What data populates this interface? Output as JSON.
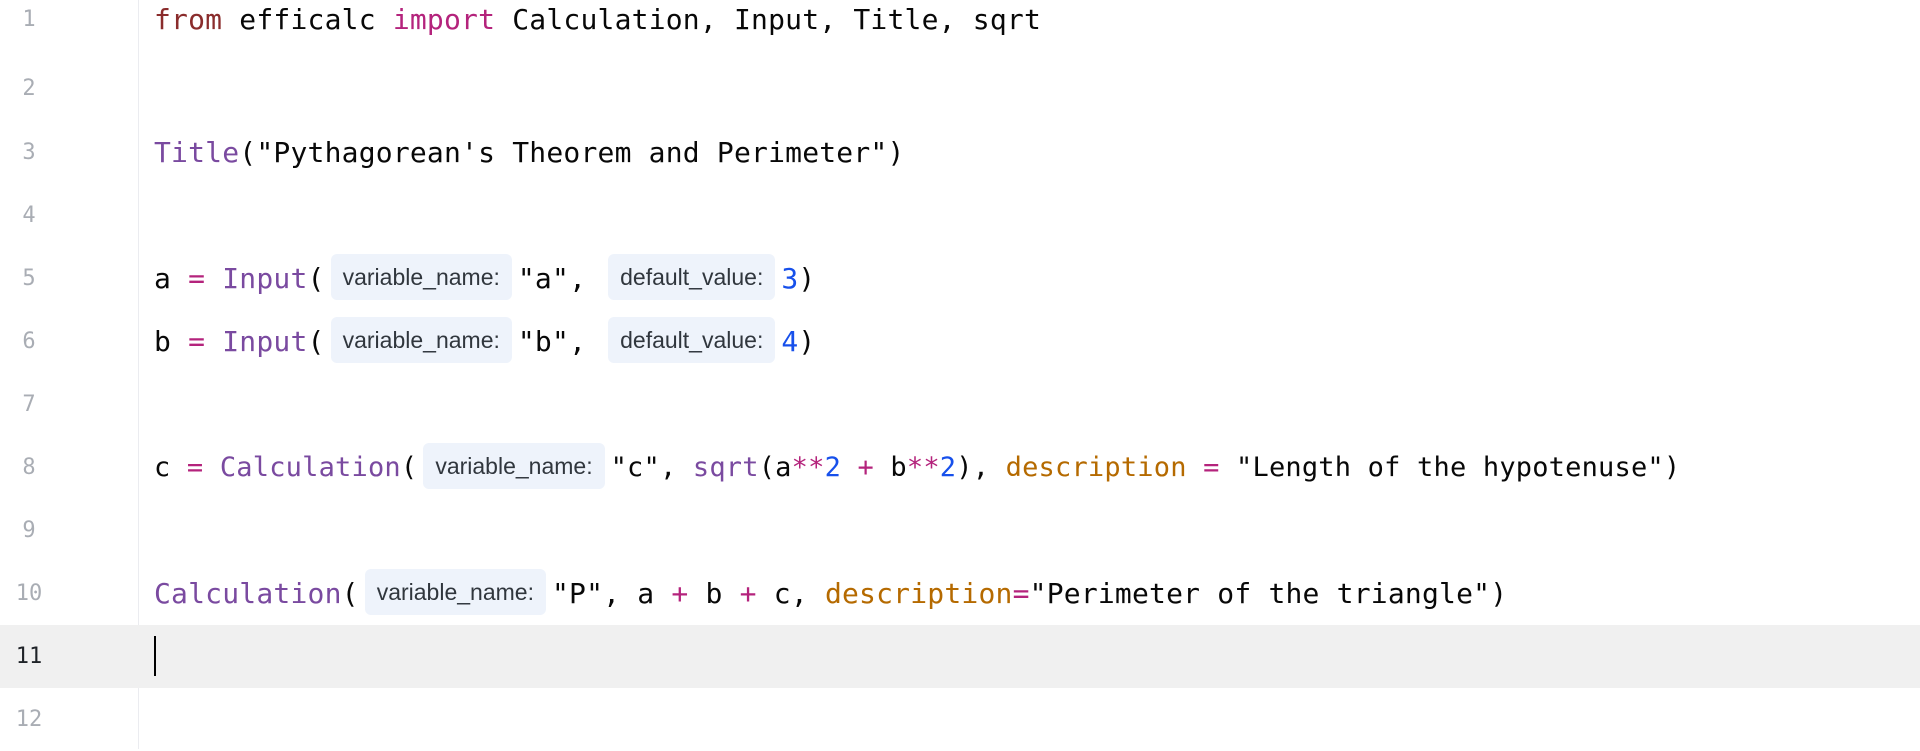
{
  "editor": {
    "lines": [
      {
        "number": "1"
      },
      {
        "number": "2"
      },
      {
        "number": "3"
      },
      {
        "number": "4"
      },
      {
        "number": "5"
      },
      {
        "number": "6"
      },
      {
        "number": "7"
      },
      {
        "number": "8"
      },
      {
        "number": "9"
      },
      {
        "number": "10"
      },
      {
        "number": "11"
      },
      {
        "number": "12"
      }
    ],
    "current_line": "11",
    "tokens": {
      "l1_from": "from",
      "l1_module": " efficalc ",
      "l1_import": "import",
      "l1_names": " Calculation, Input, Title, sqrt",
      "l3_title": "Title",
      "l3_open": "(",
      "l3_str": "\"Pythagorean's Theorem and Perimeter\"",
      "l3_close": ")",
      "l5_var": "a ",
      "l5_eq": "=",
      "l5_fn": " Input",
      "l5_open": "(",
      "l5_hint1": "variable_name:",
      "l5_str": "\"a\"",
      "l5_comma": ",",
      "l5_hint2": "default_value:",
      "l5_num": "3",
      "l5_close": ")",
      "l6_var": "b ",
      "l6_eq": "=",
      "l6_fn": " Input",
      "l6_open": "(",
      "l6_hint1": "variable_name:",
      "l6_str": "\"b\"",
      "l6_comma": ",",
      "l6_hint2": "default_value:",
      "l6_num": "4",
      "l6_close": ")",
      "l8_var": "c ",
      "l8_eq": "=",
      "l8_fn": " Calculation",
      "l8_open": "(",
      "l8_hint1": "variable_name:",
      "l8_str1": "\"c\"",
      "l8_comma1": ", ",
      "l8_sqrt": "sqrt",
      "l8_p1": "(a",
      "l8_pow1": "**",
      "l8_n1": "2",
      "l8_plus": " + ",
      "l8_b": "b",
      "l8_pow2": "**",
      "l8_n2": "2",
      "l8_p2": "), ",
      "l8_desc": "description",
      "l8_eq2": " = ",
      "l8_str2": "\"Length of the hypotenuse\"",
      "l8_close": ")",
      "l10_fn": "Calculation",
      "l10_open": "(",
      "l10_hint1": "variable_name:",
      "l10_str1": "\"P\"",
      "l10_mid": ", a ",
      "l10_plus1": "+",
      "l10_b": " b ",
      "l10_plus2": "+",
      "l10_c": " c, ",
      "l10_desc": "description",
      "l10_eq": "=",
      "l10_str2": "\"Perimeter of the triangle\"",
      "l10_close": ")"
    }
  }
}
